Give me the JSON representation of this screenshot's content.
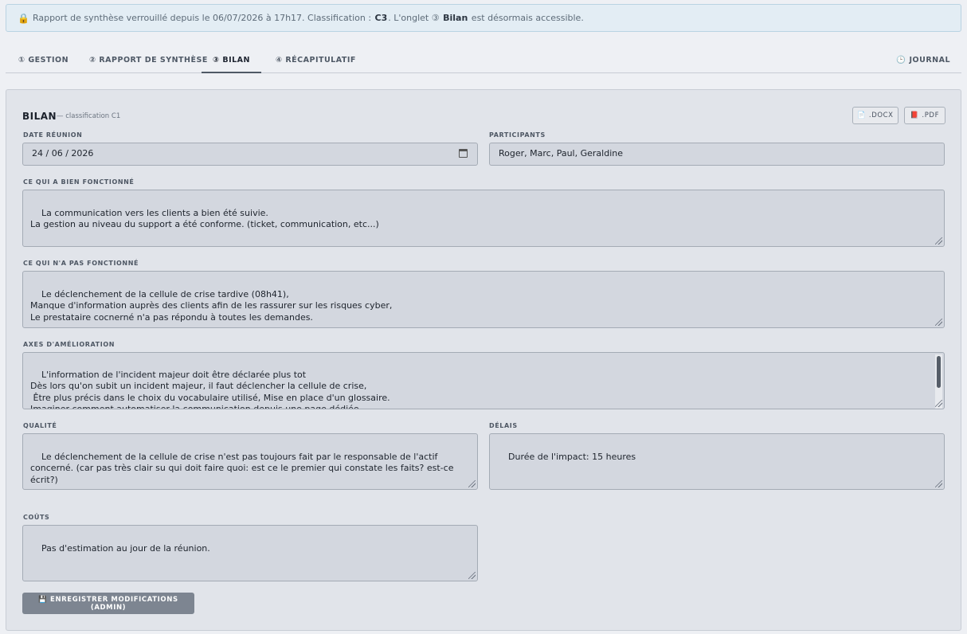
{
  "banner": {
    "lock": "🔒",
    "text_before": "Rapport de synthèse verrouillé depuis le 06/07/2026 à 17h17. Classification :",
    "classification": "C3",
    "text_middle": ". L'onglet ③",
    "tab_name": "Bilan",
    "text_after": "est désormais accessible."
  },
  "tabs": [
    {
      "label": "① GESTION"
    },
    {
      "label": "② RAPPORT DE SYNTHÈSE"
    },
    {
      "label": "③ BILAN"
    },
    {
      "label": "④ RÉCAPITULATIF"
    }
  ],
  "journal_tab": {
    "icon": "🕒",
    "label": "JOURNAL"
  },
  "panel": {
    "title": "BILAN",
    "subtitle": "— classification C1",
    "export_docx": "📄 .DOCX",
    "export_pdf": "📕 .PDF"
  },
  "form": {
    "date_label": "DATE RÉUNION",
    "date_value": "24 / 06 / 2026",
    "participants_label": "PARTICIPANTS",
    "participants_value": "Roger, Marc, Paul, Geraldine",
    "worked_label": "CE QUI A BIEN FONCTIONNÉ",
    "worked_value": "La communication vers les clients a bien été suivie.\nLa gestion au niveau du support a été conforme. (ticket, communication, etc...)",
    "failed_label": "CE QUI N'A PAS FONCTIONNÉ",
    "failed_value": "Le déclenchement de la cellule de crise tardive (08h41),\nManque d'information auprès des clients afin de les rassurer sur les risques cyber,\nLe prestataire cocnerné n'a pas répondu à toutes les demandes.",
    "improve_label": "AXES D'AMÉLIORATION",
    "improve_value": "L'information de l'incident majeur doit être déclarée plus tot\nDès lors qu'on subit un incident majeur, il faut déclencher la cellule de crise,\n Être plus précis dans le choix du vocabulaire utilisé, Mise en place d'un glossaire.\nImaginer comment automatiser la communication depuis une page dédiée\nRevoir la manière de détection Gravees les intégrations entre datadog et instatus",
    "quality_label": "QUALITÉ",
    "quality_value": "Le déclenchement de la cellule de crise n'est pas toujours fait par le responsable de l'actif concerné. (car pas très clair su qui doit faire quoi: est ce le premier qui constate les faits? est-ce écrit?)",
    "delays_label": "DÉLAIS",
    "delays_value": "Durée de l'impact: 15 heures",
    "costs_label": "COÛTS",
    "costs_value": "Pas d'estimation au jour de la réunion."
  },
  "save_button": "💾 ENREGISTRER MODIFICATIONS (ADMIN)"
}
